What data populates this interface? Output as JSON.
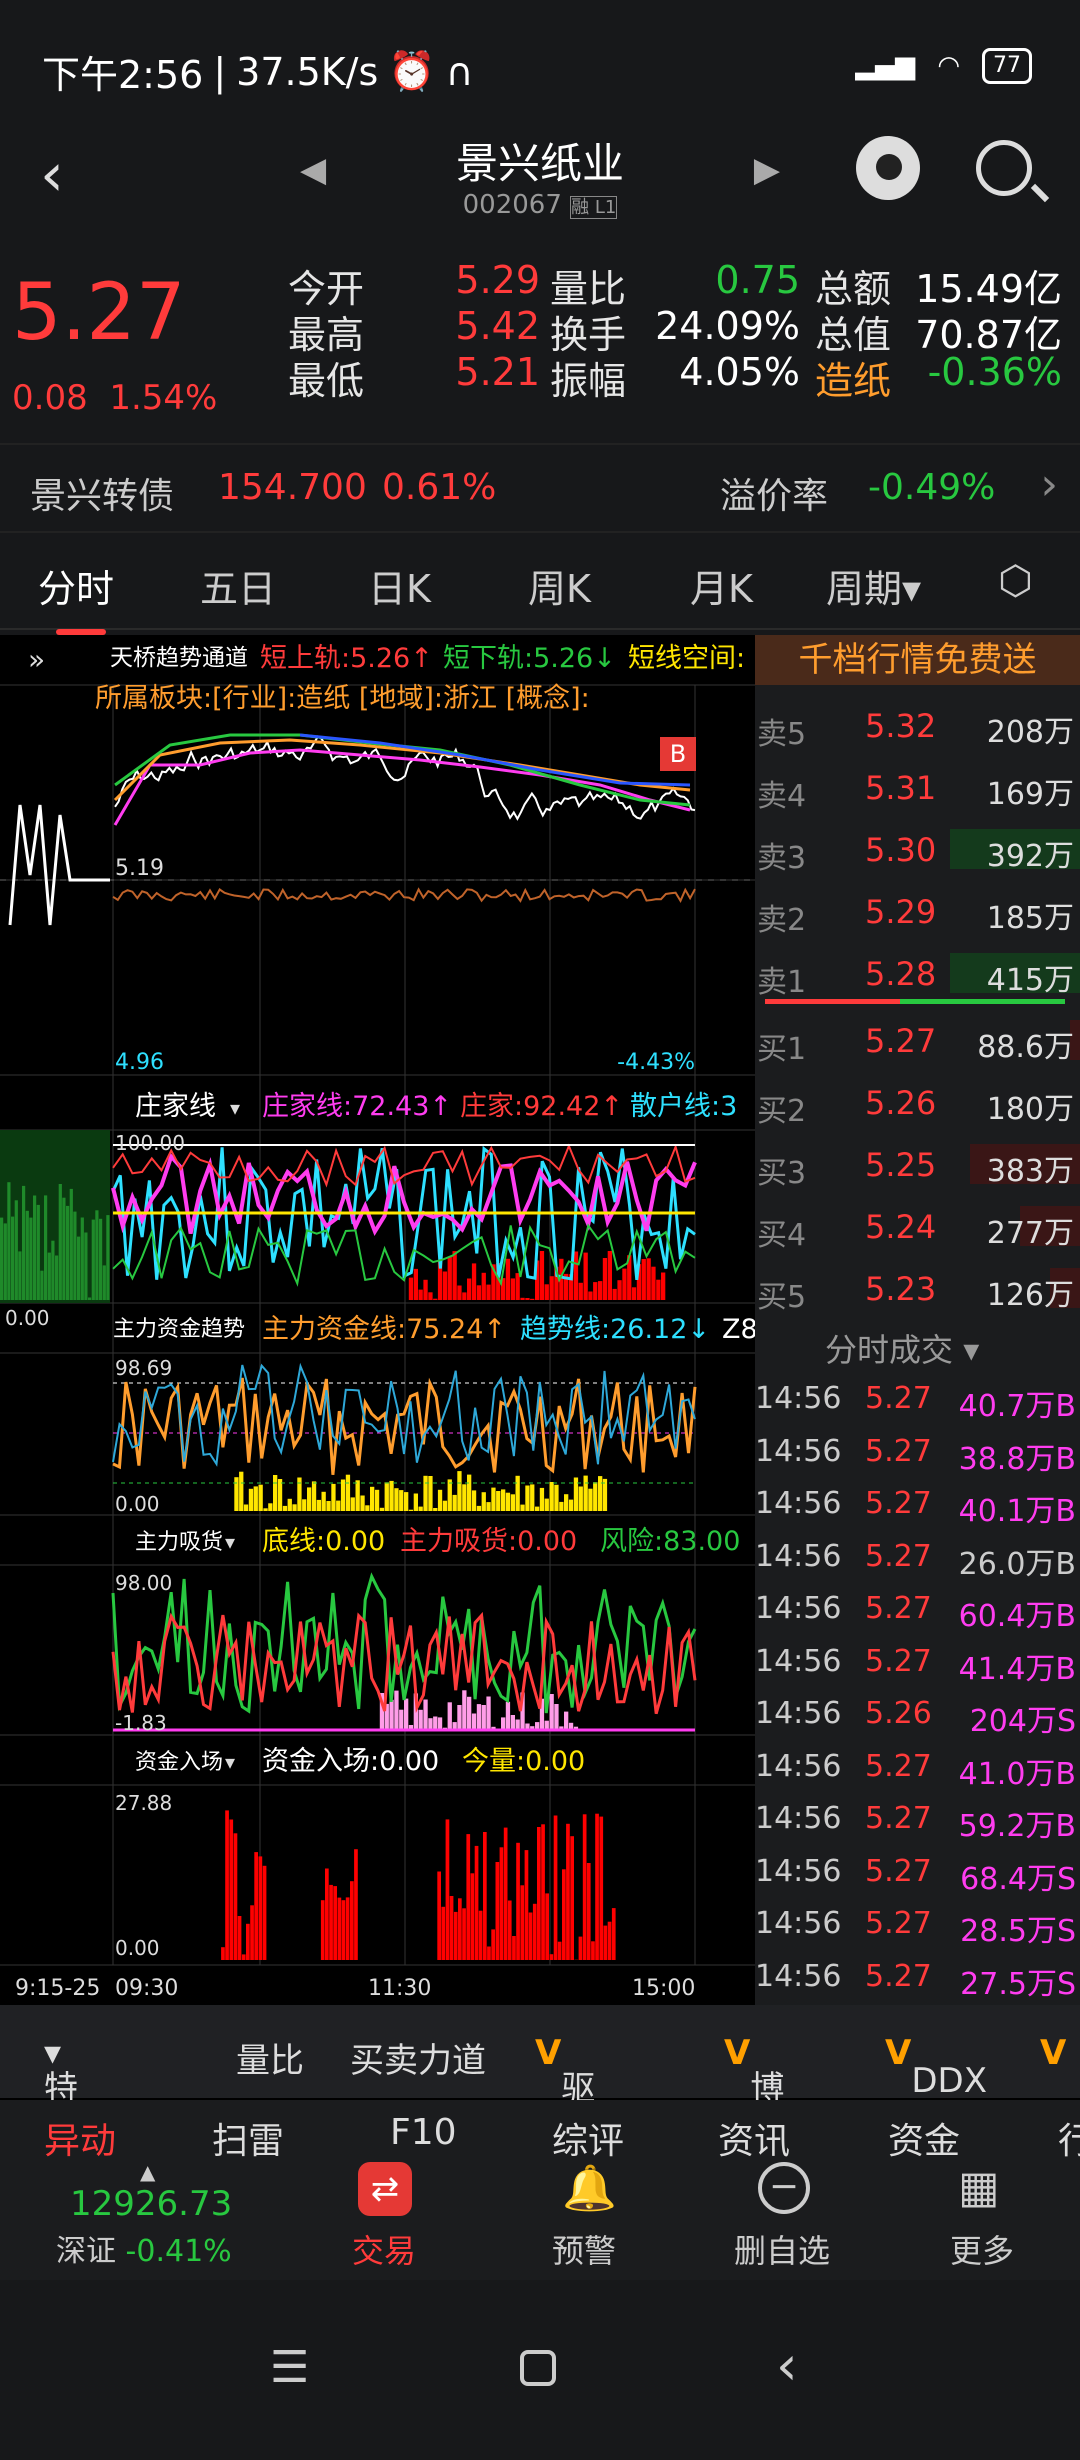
{
  "status": {
    "time": "下午2:56",
    "speed": "37.5K/s",
    "battery": "77"
  },
  "nav": {
    "title": "景兴纸业",
    "code": "002067",
    "badges": "融 L1"
  },
  "quote": {
    "price": "5.27",
    "change": "0.08",
    "pct": "1.54%",
    "grid": [
      {
        "label": "今开",
        "value": "5.29",
        "label2": "量比",
        "value2": "0.75",
        "label3": "总额",
        "value3": "15.49亿"
      },
      {
        "label": "最高",
        "value": "5.42",
        "label2": "换手",
        "value2": "24.09%",
        "label3": "总值",
        "value3": "70.87亿"
      },
      {
        "label": "最低",
        "value": "5.21",
        "label2": "振幅",
        "value2": "4.05%",
        "label3": "造纸",
        "value3": "-0.36%"
      }
    ]
  },
  "cb": {
    "name": "景兴转债",
    "price": "154.700",
    "pct": "0.61%",
    "premium_label": "溢价率",
    "premium": "-0.49%"
  },
  "tabs": [
    "分时",
    "五日",
    "日K",
    "周K",
    "月K",
    "周期"
  ],
  "chart": {
    "p1_title": "天桥趋势通道",
    "p1_l1": "短上轨:5.26↑",
    "p1_l2": "短下轨:5.26↓",
    "p1_l3": "短线空间:",
    "p1_sub": "所属板块:[行业]:造纸 [地域]:浙江 [概念]:",
    "p1_top": "5.19",
    "p1_min": "4.96",
    "p1_minpct": "-4.43%",
    "p1_badge": "B",
    "p2_title": "庄家线",
    "p2_l1": "庄家线:72.43↑",
    "p2_l2": "庄家:92.42↑",
    "p2_l3": "散户线:3",
    "p2_top": "100.00",
    "p2_bot": "0.00",
    "p3_title": "主力资金趋势",
    "p3_l1": "主力资金线:75.24↑",
    "p3_l2": "趋势线:26.12↓",
    "p3_l3": "Z8",
    "p3_top": "98.69",
    "p3_bot": "0.00",
    "p4_title": "主力吸货",
    "p4_l1": "底线:0.00",
    "p4_l2": "主力吸货:0.00",
    "p4_l3": "风险:83.00",
    "p4_top": "98.00",
    "p4_bot": "-1.83",
    "p5_title": "资金入场",
    "p5_l1": "资金入场:0.00",
    "p5_l2": "今量:0.00",
    "p5_top": "27.88",
    "p5_bot": "0.00",
    "x_labels": [
      "9:15-25",
      "09:30",
      "11:30",
      "15:00"
    ]
  },
  "orderbook": {
    "banner": "千档行情免费送",
    "asks": [
      {
        "n": "卖5",
        "p": "5.32",
        "v": "208万"
      },
      {
        "n": "卖4",
        "p": "5.31",
        "v": "169万"
      },
      {
        "n": "卖3",
        "p": "5.30",
        "v": "392万"
      },
      {
        "n": "卖2",
        "p": "5.29",
        "v": "185万"
      },
      {
        "n": "卖1",
        "p": "5.28",
        "v": "415万"
      }
    ],
    "bids": [
      {
        "n": "买1",
        "p": "5.27",
        "v": "88.6万"
      },
      {
        "n": "买2",
        "p": "5.26",
        "v": "180万"
      },
      {
        "n": "买3",
        "p": "5.25",
        "v": "383万"
      },
      {
        "n": "买4",
        "p": "5.24",
        "v": "277万"
      },
      {
        "n": "买5",
        "p": "5.23",
        "v": "126万"
      }
    ],
    "trades_title": "分时成交",
    "trades": [
      {
        "t": "14:56",
        "p": "5.27",
        "v": "40.7万B"
      },
      {
        "t": "14:56",
        "p": "5.27",
        "v": "38.8万B"
      },
      {
        "t": "14:56",
        "p": "5.27",
        "v": "40.1万B"
      },
      {
        "t": "14:56",
        "p": "5.27",
        "v": "26.0万B"
      },
      {
        "t": "14:56",
        "p": "5.27",
        "v": "60.4万B"
      },
      {
        "t": "14:56",
        "p": "5.27",
        "v": "41.4万B"
      },
      {
        "t": "14:56",
        "p": "5.26",
        "v": "204万S"
      },
      {
        "t": "14:56",
        "p": "5.27",
        "v": "41.0万B"
      },
      {
        "t": "14:56",
        "p": "5.27",
        "v": "59.2万B"
      },
      {
        "t": "14:56",
        "p": "5.27",
        "v": "68.4万S"
      },
      {
        "t": "14:56",
        "p": "5.27",
        "v": "28.5万S"
      },
      {
        "t": "14:56",
        "p": "5.27",
        "v": "27.5万S"
      }
    ]
  },
  "tools": [
    "特色",
    "量比",
    "买卖力道",
    "驱动力",
    "博弈",
    "DDX",
    "V"
  ],
  "tabs2": [
    "异动",
    "扫雷",
    "F10",
    "综评",
    "资讯",
    "资金",
    "行"
  ],
  "bottom": {
    "index_value": "12926.73",
    "index_name": "深证",
    "index_pct": "-0.41%",
    "items": [
      "交易",
      "预警",
      "删自选",
      "更多"
    ]
  }
}
